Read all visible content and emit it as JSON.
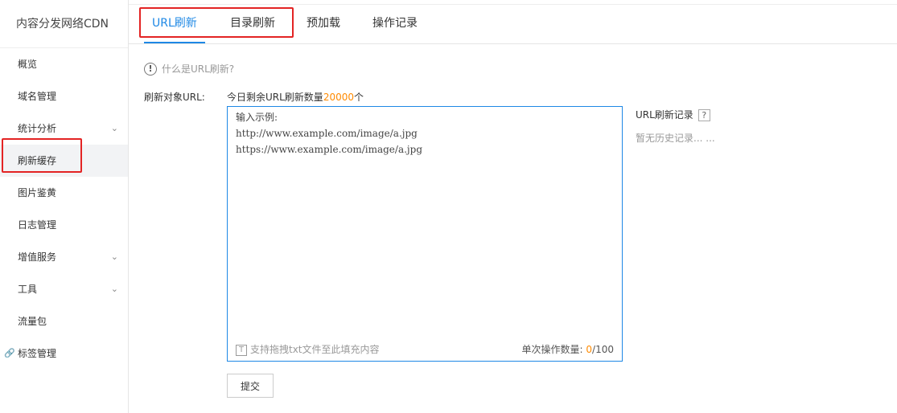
{
  "sidebar": {
    "title": "内容分发网络CDN",
    "items": [
      {
        "label": "概览",
        "chevron": false
      },
      {
        "label": "域名管理",
        "chevron": false
      },
      {
        "label": "统计分析",
        "chevron": true
      },
      {
        "label": "刷新缓存",
        "chevron": false,
        "active": true
      },
      {
        "label": "图片鉴黄",
        "chevron": false
      },
      {
        "label": "日志管理",
        "chevron": false
      },
      {
        "label": "增值服务",
        "chevron": true
      },
      {
        "label": "工具",
        "chevron": true
      },
      {
        "label": "流量包",
        "chevron": false
      },
      {
        "label": "标签管理",
        "chevron": false,
        "link_icon": true
      }
    ]
  },
  "tabs": [
    {
      "label": "URL刷新",
      "active": true
    },
    {
      "label": "目录刷新",
      "active": false
    },
    {
      "label": "预加载",
      "active": false
    },
    {
      "label": "操作记录",
      "active": false
    }
  ],
  "help": {
    "text": "什么是URL刷新?"
  },
  "form": {
    "label": "刷新对象URL:",
    "quota_prefix": "今日剩余URL刷新数量",
    "quota_value": "20000",
    "quota_suffix": "个",
    "textarea_placeholder": "输入示例:\nhttp://www.example.com/image/a.jpg\nhttps://www.example.com/image/a.jpg",
    "drag_hint": "支持拖拽txt文件至此填充内容",
    "count_label": "单次操作数量:",
    "count_current": "0",
    "count_max": "/100",
    "submit_label": "提交"
  },
  "records": {
    "title": "URL刷新记录",
    "help_icon": "?",
    "empty_text": "暂无历史记录... ..."
  },
  "colors": {
    "accent": "#1e88e5",
    "highlight": "#e32424",
    "orange": "#ff8a00"
  }
}
